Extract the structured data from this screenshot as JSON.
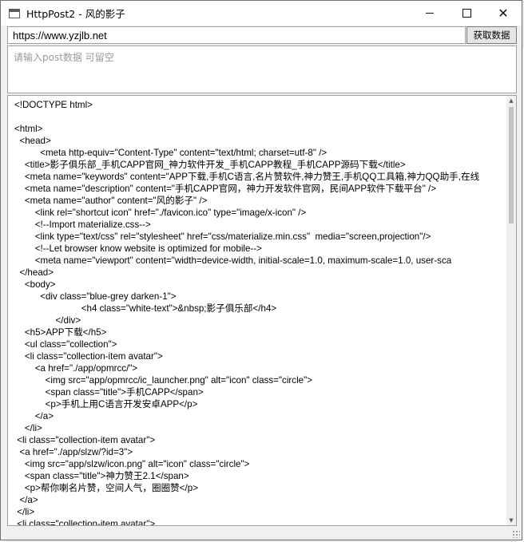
{
  "window": {
    "title": "HttpPost2 - 风的影子"
  },
  "controls": {
    "minimize_icon": "minimize-icon",
    "maximize_icon": "maximize-icon",
    "close_icon": "close-icon",
    "close_glyph": "✕"
  },
  "request": {
    "url": "https://www.yzjlb.net",
    "fetch_label": "获取数据",
    "post_placeholder": "请输入post数据 可留空"
  },
  "response": {
    "lines": [
      "<!DOCTYPE html>",
      "",
      "<html>",
      "  <head>",
      "          <meta http-equiv=\"Content-Type\" content=\"text/html; charset=utf-8\" />",
      "    <title>影子俱乐部_手机CAPP官网_神力软件开发_手机CAPP教程_手机CAPP源码下载</title>",
      "    <meta name=\"keywords\" content=\"APP下载,手机C语言,名片赞软件,神力赞王,手机QQ工具箱,神力QQ助手,在线",
      "    <meta name=\"description\" content=\"手机CAPP官网，神力开发软件官网，民间APP软件下载平台\" />",
      "    <meta name=\"author\" content=\"风的影子\" />",
      "        <link rel=\"shortcut icon\" href=\"./favicon.ico\" type=\"image/x-icon\" />",
      "        <!--Import materialize.css-->",
      "        <link type=\"text/css\" rel=\"stylesheet\" href=\"css/materialize.min.css\"  media=\"screen,projection\"/>",
      "        <!--Let browser know website is optimized for mobile-->",
      "        <meta name=\"viewport\" content=\"width=device-width, initial-scale=1.0, maximum-scale=1.0, user-sca",
      "  </head>",
      "    <body>",
      "          <div class=\"blue-grey darken-1\">",
      "                          <h4 class=\"white-text\">&nbsp;影子俱乐部</h4>",
      "                </div>",
      "    <h5>APP下载</h5>",
      "    <ul class=\"collection\">",
      "    <li class=\"collection-item avatar\">",
      "        <a href=\"./app/opmrcc/\">",
      "            <img src=\"app/opmrcc/ic_launcher.png\" alt=\"icon\" class=\"circle\">",
      "            <span class=\"title\">手机CAPP</span>",
      "            <p>手机上用C语言开发安卓APP</p>",
      "        </a>",
      "    </li>",
      " <li class=\"collection-item avatar\">",
      "  <a href=\"./app/slzw/?id=3\">",
      "    <img src=\"app/slzw/icon.png\" alt=\"icon\" class=\"circle\">",
      "    <span class=\"title\">神力赞王2.1</span>",
      "    <p>帮你喇名片赞，空间人气，圈圈赞</p>",
      "  </a>",
      " </li>",
      " <li class=\"collection-item avatar\">"
    ]
  }
}
